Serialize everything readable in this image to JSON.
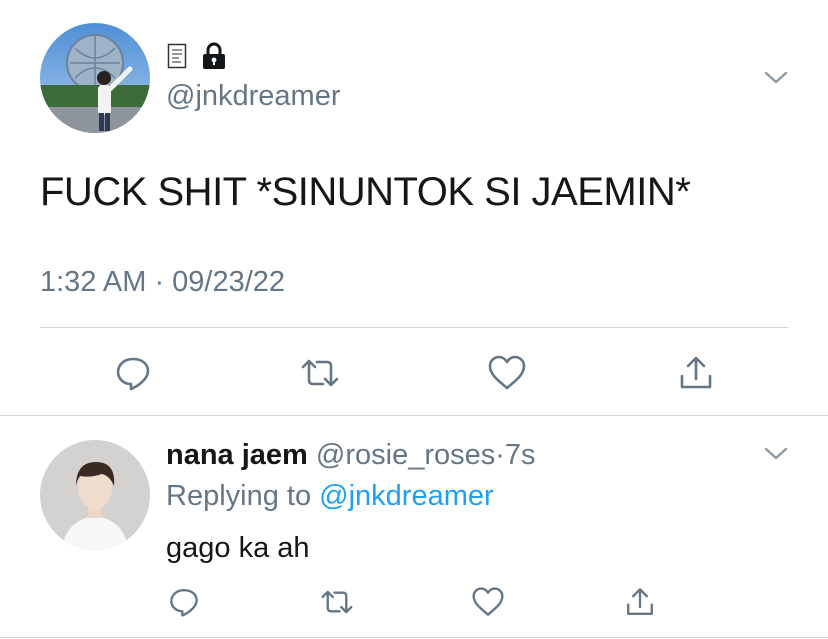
{
  "main_tweet": {
    "handle": "@jnkdreamer",
    "text": "FUCK SHIT *SINUNTOK SI JAEMIN*",
    "timestamp": "1:32 AM · 09/23/22",
    "name_icons": [
      "scroll-icon",
      "lock-icon"
    ],
    "actions": [
      "reply-icon",
      "retweet-icon",
      "like-icon",
      "share-icon"
    ]
  },
  "reply": {
    "name": "nana jaem",
    "handle": "@rosie_roses",
    "separator": "·",
    "time": "7s",
    "replying_prefix": "Replying to",
    "replying_to": "@jnkdreamer",
    "text": "gago ka ah",
    "actions": [
      "reply-icon",
      "retweet-icon",
      "like-icon",
      "share-icon"
    ]
  },
  "colors": {
    "text": "#14171a",
    "secondary": "#657786",
    "link": "#1da1f2",
    "divider": "#cfd7de",
    "icon": "#657786"
  }
}
